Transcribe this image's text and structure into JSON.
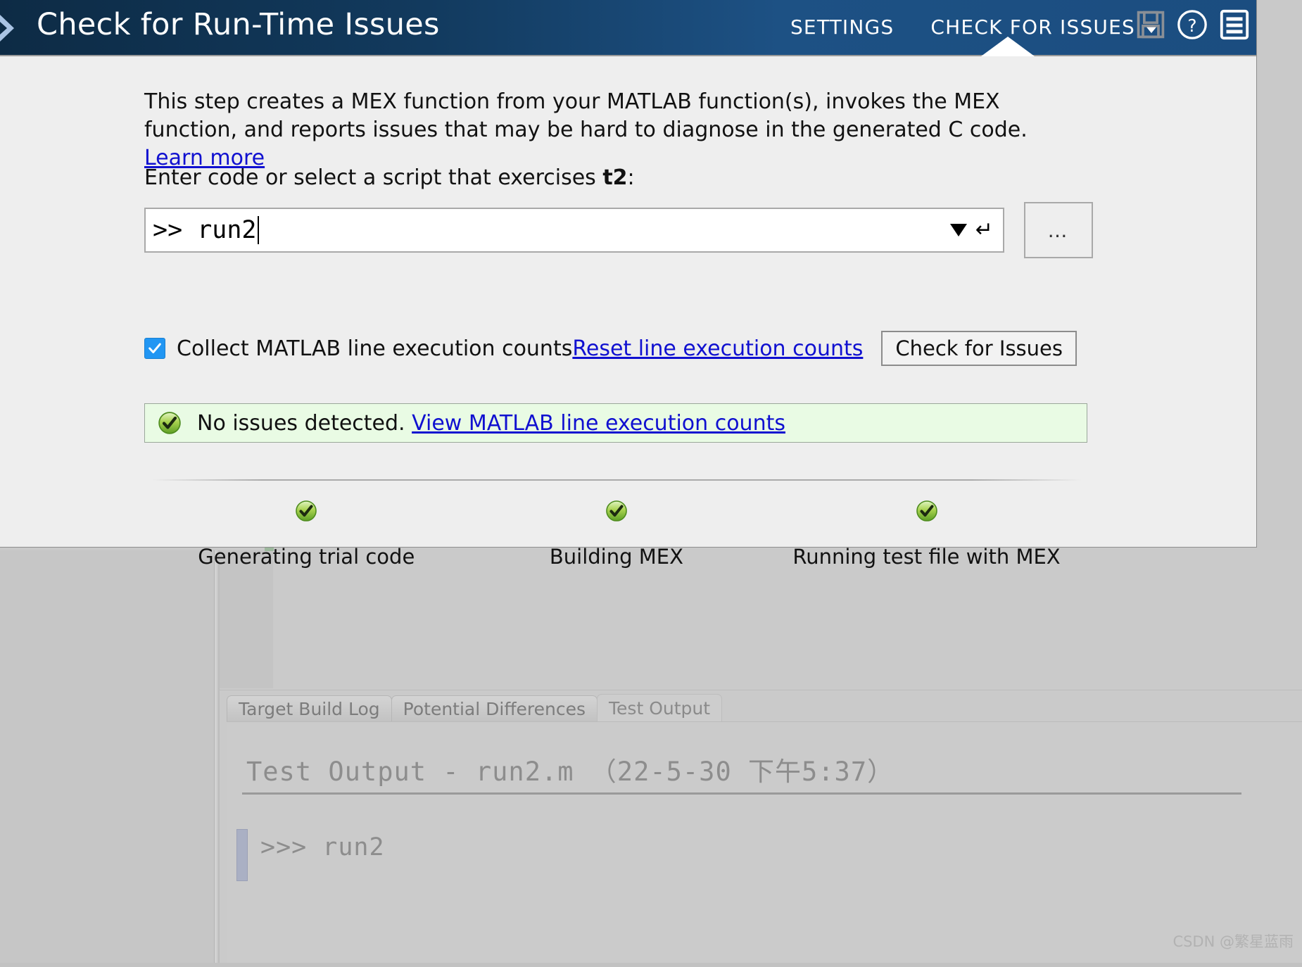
{
  "header": {
    "title": "Check for Run-Time Issues",
    "expand_icon": "chevron-right-icon",
    "settings_label": "SETTINGS",
    "check_label": "CHECK FOR ISSUES",
    "icons": [
      "save-icon",
      "help-icon",
      "menu-icon"
    ],
    "bg_dark": "#0d2b45",
    "bg_light": "#1d5184"
  },
  "description": {
    "text": "This step creates a MEX function from your MATLAB function(s), invokes the MEX function, and reports issues that may be hard to diagnose in the generated C code. ",
    "link": "Learn more"
  },
  "prompt": {
    "prefix": "Enter code or select a script that exercises ",
    "target": "t2",
    "suffix": ":"
  },
  "input": {
    "value": ">> run2",
    "dropdown_icon": "chevron-down-icon",
    "enter_icon": "return-arrow-icon",
    "browse_label": "…"
  },
  "options": {
    "checkbox_label": "Collect MATLAB line execution counts",
    "checkbox_checked": true,
    "checkbox_color": "#2196f3",
    "reset_link": "Reset line execution counts",
    "check_button": "Check for Issues"
  },
  "banner": {
    "icon": "success-check-icon",
    "message": "No issues detected. ",
    "link": "View MATLAB line execution counts",
    "bg_color": "#e9fbe4"
  },
  "steps": [
    {
      "label": "Generating trial code",
      "status": "success"
    },
    {
      "label": "Building MEX",
      "status": "success"
    },
    {
      "label": "Running test file with MEX",
      "status": "success"
    }
  ],
  "tabs": [
    {
      "label": "Target Build Log",
      "active": false
    },
    {
      "label": "Potential Differences",
      "active": false
    },
    {
      "label": "Test Output",
      "active": true
    }
  ],
  "output": {
    "title": "Test Output - run2.m  （22-5-30 下午5:37）",
    "line": ">>> run2"
  },
  "watermark": "CSDN @繁星蓝雨"
}
